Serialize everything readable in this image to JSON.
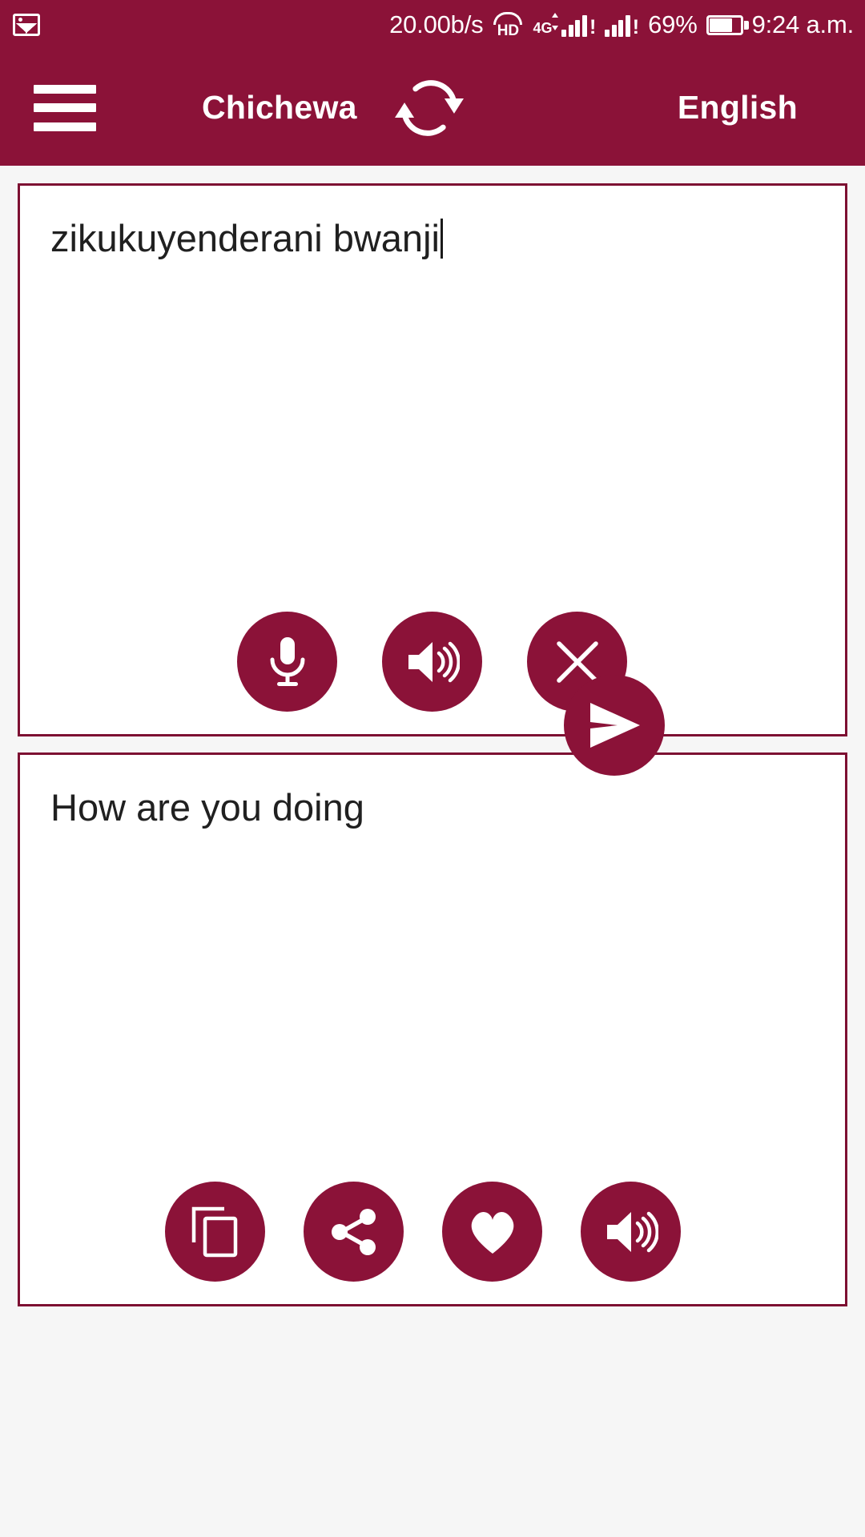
{
  "theme": {
    "primary": "#8B1238",
    "border": "#7D1032",
    "background": "#F6F6F6",
    "on_primary": "#FFFFFF",
    "text": "#202020"
  },
  "status_bar": {
    "left_icon": "image-icon",
    "network_speed": "20.00b/s",
    "hd_label": "HD",
    "network_type": "4G",
    "signal_1_bang": "!",
    "signal_2_bang": "!",
    "battery_percent": "69%",
    "battery_icon": "battery-icon",
    "time": "9:24 a.m."
  },
  "app_bar": {
    "menu_icon": "hamburger-menu-icon",
    "source_language": "Chichewa",
    "swap_icon": "swap-languages-icon",
    "target_language": "English"
  },
  "input_card": {
    "text": "zikukuyenderani bwanji",
    "has_caret": true,
    "buttons": [
      {
        "name": "microphone-button",
        "icon": "microphone-icon",
        "label": "Voice input"
      },
      {
        "name": "speak-source-button",
        "icon": "speaker-icon",
        "label": "Speak"
      },
      {
        "name": "clear-button",
        "icon": "close-icon",
        "label": "Clear"
      }
    ]
  },
  "send_button": {
    "name": "send-button",
    "icon": "send-icon",
    "label": "Translate"
  },
  "output_card": {
    "text": "How are you doing",
    "buttons": [
      {
        "name": "copy-button",
        "icon": "copy-icon",
        "label": "Copy"
      },
      {
        "name": "share-button",
        "icon": "share-icon",
        "label": "Share"
      },
      {
        "name": "favorite-button",
        "icon": "heart-icon",
        "label": "Favorite"
      },
      {
        "name": "speak-result-button",
        "icon": "speaker-icon",
        "label": "Speak"
      }
    ]
  }
}
